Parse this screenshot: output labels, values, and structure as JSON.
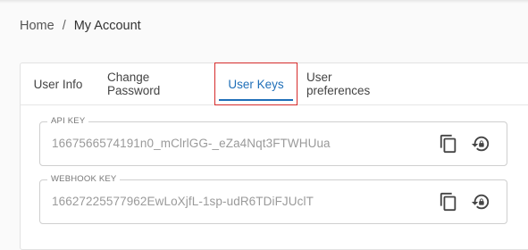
{
  "breadcrumb": {
    "home": "Home",
    "separator": "/",
    "current": "My Account"
  },
  "tabs": [
    {
      "label": "User Info",
      "active": false
    },
    {
      "label": "Change Password",
      "active": false
    },
    {
      "label": "User Keys",
      "active": true
    },
    {
      "label": "User preferences",
      "active": false
    }
  ],
  "fields": {
    "api_key": {
      "label": "API KEY",
      "value": "1667566574191n0_mClrlGG-_eZa4Nqt3FTWHUua"
    },
    "webhook_key": {
      "label": "WEBHOOK KEY",
      "value": "16627225577962EwLoXjfL-1sp-udR6TDiFJUclT"
    }
  },
  "icons": {
    "copy": "copy-icon",
    "regenerate": "lock-reset-icon"
  },
  "colors": {
    "accent": "#1f6fb8",
    "highlight_border": "#d62b2b",
    "value_text": "#9a9a9a"
  }
}
